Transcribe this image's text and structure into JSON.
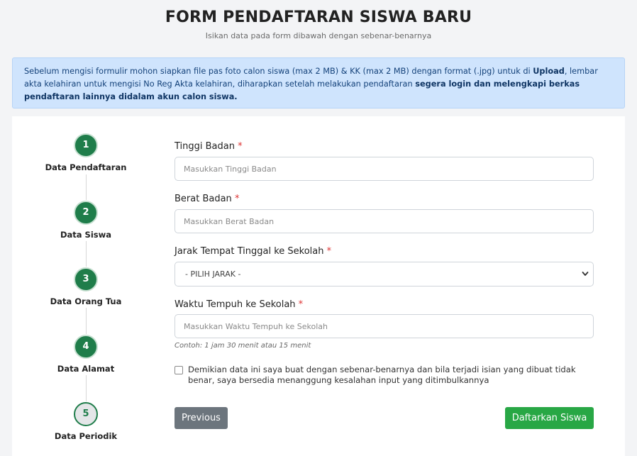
{
  "header": {
    "title": "FORM PENDAFTARAN SISWA BARU",
    "subtitle": "Isikan data pada form dibawah dengan sebenar-benarnya"
  },
  "notice": {
    "part1": "Sebelum mengisi formulir mohon siapkan file pas foto calon siswa (max 2 MB) & KK (max 2 MB) dengan format (.jpg) untuk di ",
    "upload": "Upload",
    "part2": ", lembar akta kelahiran untuk mengisi No Reg Akta kelahiran, diharapkan setelah melakukan pendaftaran ",
    "emphasis": "segera login dan melengkapi berkas pendaftaran lainnya didalam akun calon siswa."
  },
  "steps": [
    {
      "number": "1",
      "label": "Data Pendaftaran"
    },
    {
      "number": "2",
      "label": "Data Siswa"
    },
    {
      "number": "3",
      "label": "Data Orang Tua"
    },
    {
      "number": "4",
      "label": "Data Alamat"
    },
    {
      "number": "5",
      "label": "Data Periodik"
    }
  ],
  "form": {
    "required_mark": "*",
    "tinggi": {
      "label": "Tinggi Badan",
      "placeholder": "Masukkan Tinggi Badan",
      "value": ""
    },
    "berat": {
      "label": "Berat Badan",
      "placeholder": "Masukkan Berat Badan",
      "value": ""
    },
    "jarak": {
      "label": "Jarak Tempat Tinggal ke Sekolah",
      "selected": "- PILIH JARAK -"
    },
    "waktu": {
      "label": "Waktu Tempuh ke Sekolah",
      "placeholder": "Masukkan Waktu Tempuh ke Sekolah",
      "value": "",
      "hint": "Contoh: 1 jam 30 menit atau 15 menit"
    },
    "agreement": "Demikian data ini saya buat dengan sebenar-benarnya dan bila terjadi isian yang dibuat tidak benar, saya bersedia menanggung kesalahan input yang ditimbulkannya",
    "previous_label": "Previous",
    "submit_label": "Daftarkan Siswa"
  },
  "colors": {
    "step_green": "#1f7d4a",
    "submit_green": "#28a745",
    "previous_gray": "#6c757d",
    "alert_bg": "#cfe4fd"
  }
}
